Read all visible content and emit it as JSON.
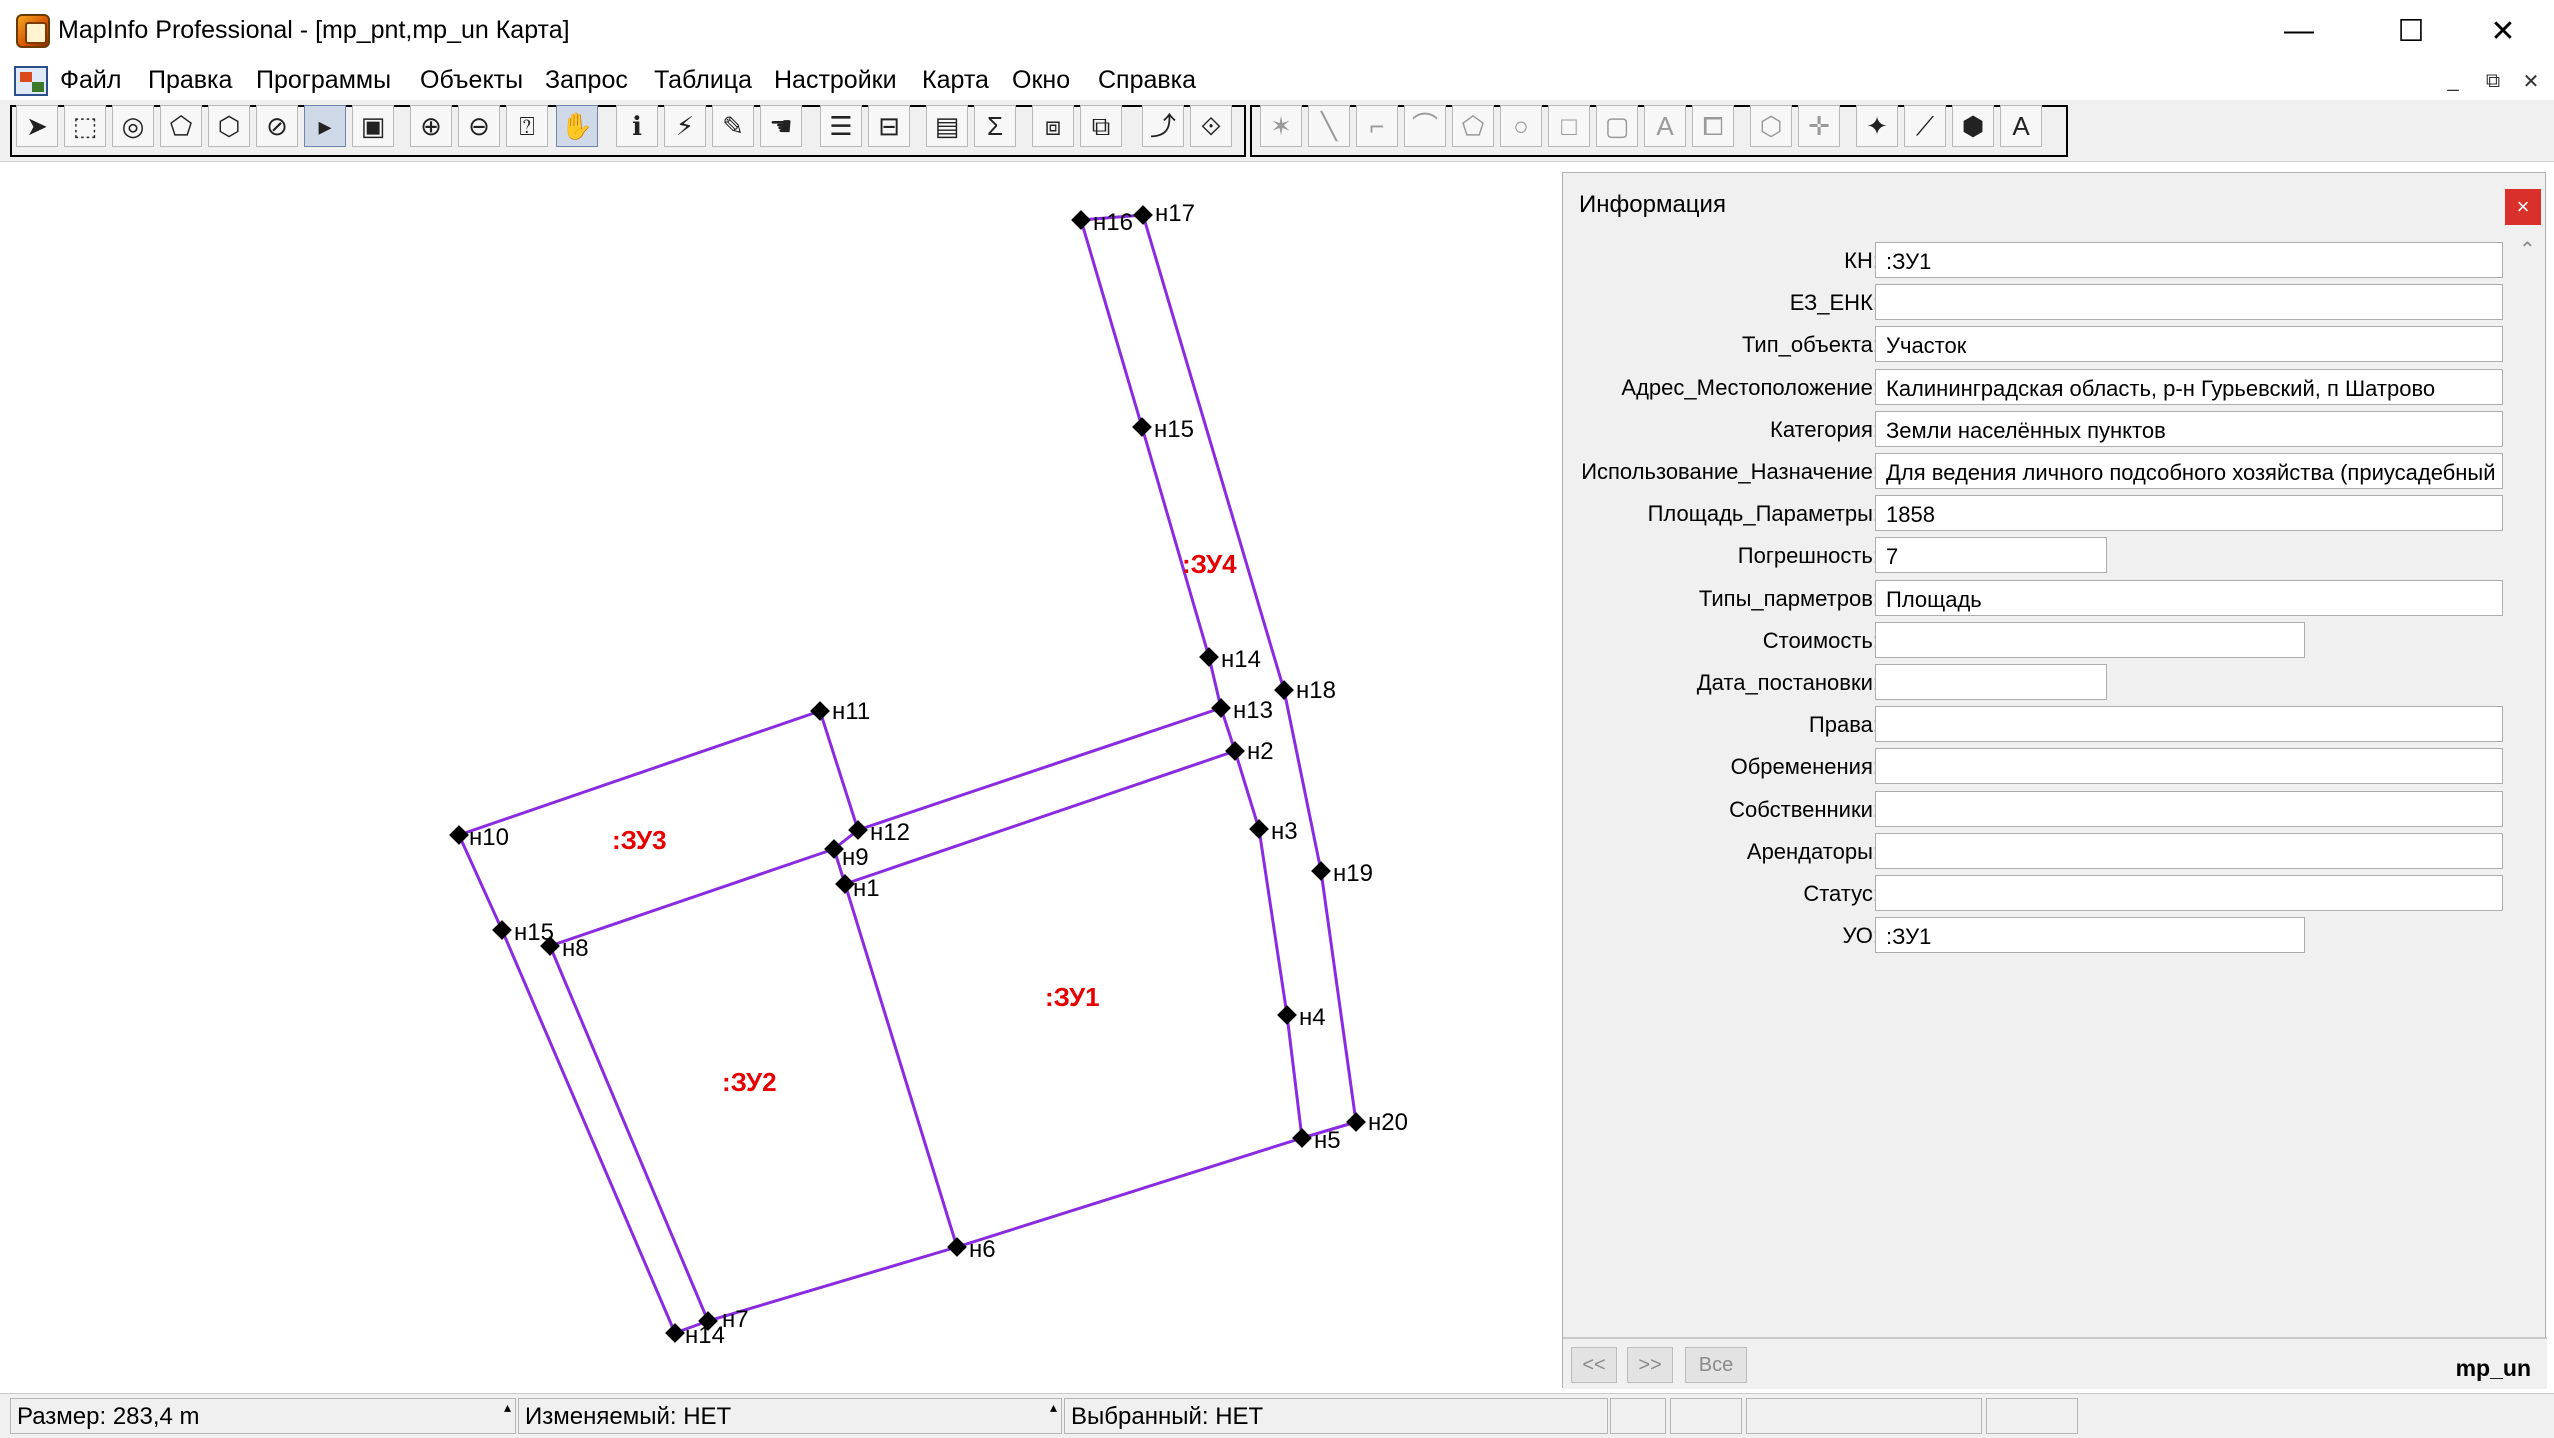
{
  "window": {
    "title": "MapInfo Professional - [mp_pnt,mp_un Карта]",
    "minimize_glyph": "—",
    "maximize_glyph": "☐",
    "close_glyph": "✕"
  },
  "menu": {
    "items": [
      "Файл",
      "Правка",
      "Программы",
      "Объекты",
      "Запрос",
      "Таблица",
      "Настройки",
      "Карта",
      "Окно",
      "Справка"
    ],
    "mdi_controls": [
      "_",
      "⧉",
      "✕"
    ]
  },
  "toolbar": {
    "icons": [
      {
        "name": "select-arrow-icon",
        "glyph": "➤",
        "active": false
      },
      {
        "name": "marquee-select-icon",
        "glyph": "⬚",
        "active": false
      },
      {
        "name": "radius-select-icon",
        "glyph": "◎",
        "active": false
      },
      {
        "name": "polygon-select-icon",
        "glyph": "⬠",
        "active": false
      },
      {
        "name": "boundary-select-icon",
        "glyph": "⬡",
        "active": false
      },
      {
        "name": "unselect-icon",
        "glyph": "⊘",
        "active": false
      },
      {
        "name": "graph-select-icon",
        "glyph": "▸",
        "active": true
      },
      {
        "name": "invert-select-icon",
        "glyph": "▣",
        "active": false
      },
      {
        "name": "zoom-in-icon",
        "glyph": "⊕",
        "active": false
      },
      {
        "name": "zoom-out-icon",
        "glyph": "⊖",
        "active": false
      },
      {
        "name": "change-view-icon",
        "glyph": "⍰",
        "active": false
      },
      {
        "name": "pan-hand-icon",
        "glyph": "✋",
        "active": true
      },
      {
        "name": "info-tool-icon",
        "glyph": "ℹ",
        "active": false
      },
      {
        "name": "hotlink-icon",
        "glyph": "⚡",
        "active": false
      },
      {
        "name": "label-tool-icon",
        "glyph": "✎",
        "active": false
      },
      {
        "name": "drag-map-icon",
        "glyph": "☚",
        "active": false
      },
      {
        "name": "layer-control-icon",
        "glyph": "☰",
        "active": false
      },
      {
        "name": "ruler-icon",
        "glyph": "⊟",
        "active": false
      },
      {
        "name": "legend-icon",
        "glyph": "▤",
        "active": false
      },
      {
        "name": "statistics-sigma-icon",
        "glyph": "Σ",
        "active": false
      },
      {
        "name": "clip-region-icon",
        "glyph": "⧈",
        "active": false
      },
      {
        "name": "set-target-icon",
        "glyph": "⧉",
        "active": false
      },
      {
        "name": "redistrict-icon",
        "glyph": "⤴",
        "active": false
      },
      {
        "name": "reshape-icon",
        "glyph": "⟐",
        "active": false
      },
      {
        "name": "symbol-draw-icon",
        "glyph": "✶",
        "active": false
      },
      {
        "name": "line-draw-icon",
        "glyph": "╲",
        "active": false
      },
      {
        "name": "polyline-draw-icon",
        "glyph": "⌐",
        "active": false
      },
      {
        "name": "arc-draw-icon",
        "glyph": "⌒",
        "active": false
      },
      {
        "name": "polygon-draw-icon",
        "glyph": "⬠",
        "active": false
      },
      {
        "name": "ellipse-draw-icon",
        "glyph": "○",
        "active": false
      },
      {
        "name": "rectangle-draw-icon",
        "glyph": "□",
        "active": false
      },
      {
        "name": "rounded-rect-draw-icon",
        "glyph": "▢",
        "active": false
      },
      {
        "name": "text-draw-icon",
        "glyph": "A",
        "active": false
      },
      {
        "name": "frame-draw-icon",
        "glyph": "⧠",
        "active": false
      },
      {
        "name": "reshape-nodes-icon",
        "glyph": "⬡",
        "active": false
      },
      {
        "name": "add-node-icon",
        "glyph": "✛",
        "active": false
      },
      {
        "name": "style-symbol-icon",
        "glyph": "✦",
        "active": false
      },
      {
        "name": "style-line-icon",
        "glyph": "⟋",
        "active": false
      },
      {
        "name": "style-region-icon",
        "glyph": "⬢",
        "active": false
      },
      {
        "name": "style-text-icon",
        "glyph": "A",
        "active": false
      }
    ]
  },
  "map": {
    "line_color": "#8a2be2",
    "label_color": "#e60000",
    "points": [
      {
        "label": "н16"
      },
      {
        "label": "н17"
      },
      {
        "label": "н15"
      },
      {
        "label": "н14"
      },
      {
        "label": "н18"
      },
      {
        "label": "н13"
      },
      {
        "label": "н2"
      },
      {
        "label": "н11"
      },
      {
        "label": "н12"
      },
      {
        "label": "н9"
      },
      {
        "label": "н1"
      },
      {
        "label": "н3"
      },
      {
        "label": "н19"
      },
      {
        "label": "н10"
      },
      {
        "label": "н15"
      },
      {
        "label": "н8"
      },
      {
        "label": "н4"
      },
      {
        "label": "н20"
      },
      {
        "label": "н5"
      },
      {
        "label": "н6"
      },
      {
        "label": "н7"
      },
      {
        "label": "н14"
      }
    ],
    "zu_labels": [
      ":ЗУ4",
      ":ЗУ3",
      ":ЗУ1",
      ":ЗУ2"
    ]
  },
  "info": {
    "title": "Информация",
    "close_glyph": "×",
    "fields": [
      {
        "label": "КН:",
        "value": ":ЗУ1",
        "width": "wide"
      },
      {
        "label": "ЕЗ_ЕНК:",
        "value": "",
        "width": "wide"
      },
      {
        "label": "Тип_объекта:",
        "value": "Участок",
        "width": "wide"
      },
      {
        "label": "Адрес_Местоположение:",
        "value": "Калининградская область, р-н Гурьевский, п Шатрово",
        "width": "wide"
      },
      {
        "label": "Категория:",
        "value": "Земли населённых пунктов",
        "width": "wide"
      },
      {
        "label": "Использование_Назначение:",
        "value": "Для ведения личного подсобного хозяйства (приусадебный",
        "width": "wide"
      },
      {
        "label": "Площадь_Параметры:",
        "value": "1858",
        "width": "wide"
      },
      {
        "label": "Погрешность:",
        "value": "7",
        "width": "small"
      },
      {
        "label": "Типы_парметров:",
        "value": "Площадь",
        "width": "wide"
      },
      {
        "label": "Стоимость:",
        "value": "",
        "width": "medium"
      },
      {
        "label": "Дата_постановки:",
        "value": "",
        "width": "small"
      },
      {
        "label": "Права:",
        "value": "",
        "width": "wide"
      },
      {
        "label": "Обременения:",
        "value": "",
        "width": "wide"
      },
      {
        "label": "Собственники:",
        "value": "",
        "width": "wide"
      },
      {
        "label": "Арендаторы:",
        "value": "",
        "width": "wide"
      },
      {
        "label": "Статус:",
        "value": "",
        "width": "wide"
      },
      {
        "label": "УО:",
        "value": ":ЗУ1",
        "width": "medium"
      }
    ],
    "nav_prev": "<<",
    "nav_next": ">>",
    "nav_all": "Все",
    "table_name": "mp_un"
  },
  "status": {
    "size": "Размер: 283,4 m",
    "editable": "Изменяемый: НЕТ",
    "selected": "Выбранный: НЕТ"
  }
}
